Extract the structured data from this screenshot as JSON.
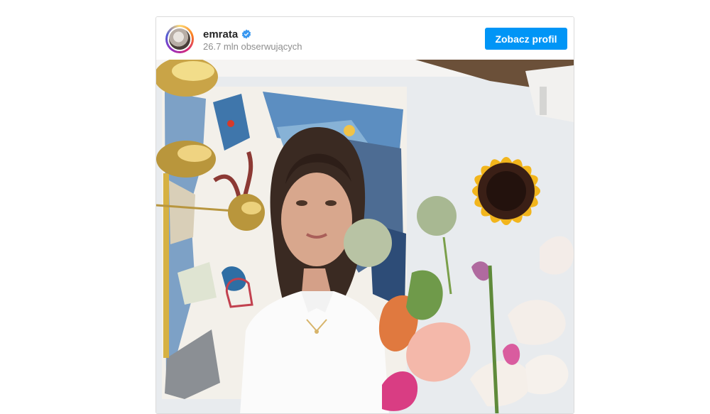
{
  "post": {
    "username": "emrata",
    "verified_icon": "verified-badge-icon",
    "followers": "26.7 mln obserwujących",
    "profile_button_label": "Zobacz profil",
    "image_description_icon": "photo-icon"
  },
  "colors": {
    "accent": "#0095f6",
    "verified": "#3897f0",
    "username": "#262626",
    "muted": "#8e8e8e",
    "border": "#dbdbdb"
  }
}
